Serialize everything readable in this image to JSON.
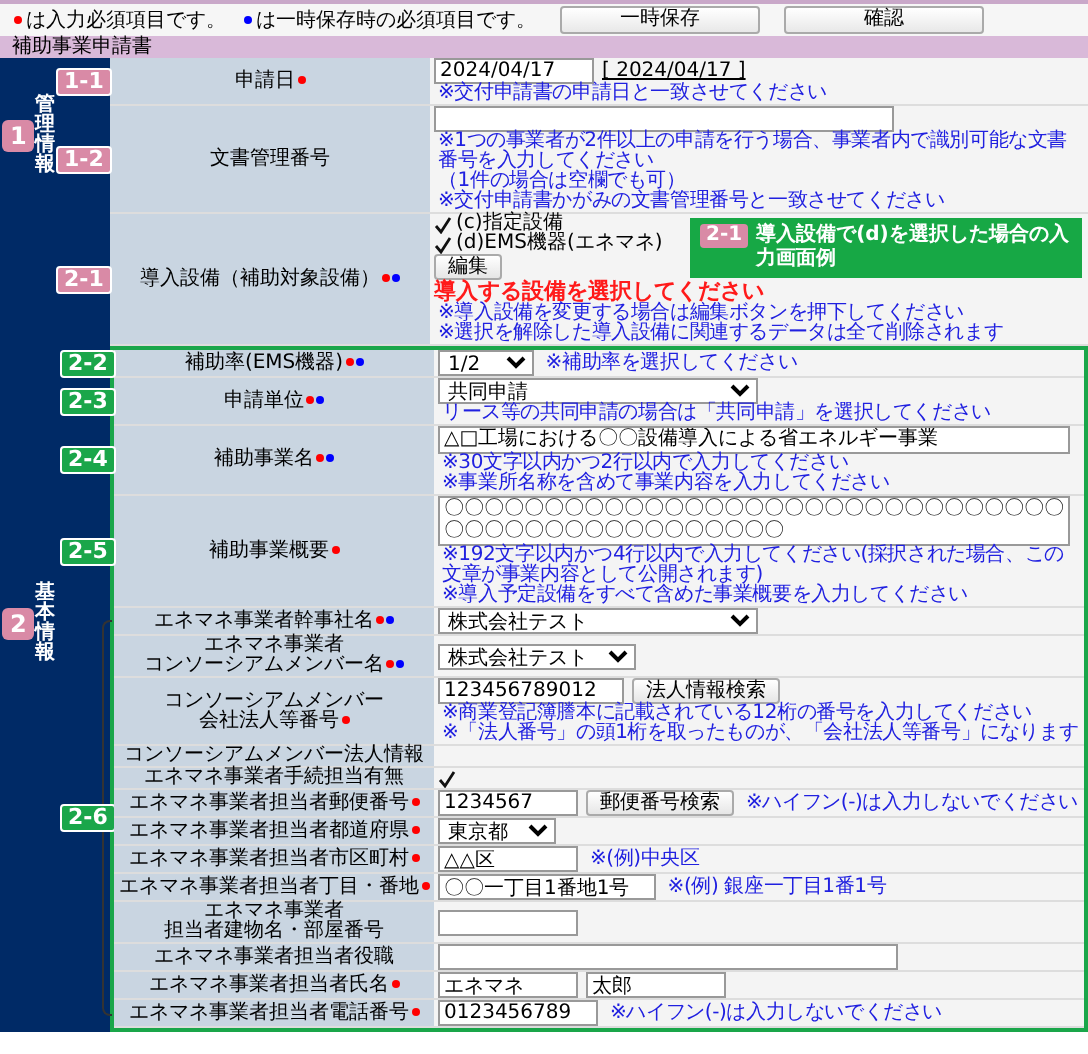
{
  "toolbar": {
    "buttons": [
      {
        "label": "一時保存"
      },
      {
        "label": "確認"
      }
    ]
  },
  "legend": [
    {
      "color": "#ff0000",
      "text": "は入力必須項目です。"
    },
    {
      "color": "#0000ff",
      "text": "は一時保存時の必須項目です。"
    }
  ],
  "form_title": "補助事業申請書",
  "sections": [
    {
      "badge": {
        "label": "1",
        "color": "#d98aa6"
      },
      "title": "管理情報",
      "rows": [
        {
          "badge": {
            "label": "1-1",
            "color": "#d98aa6"
          },
          "label": [
            "申請日"
          ],
          "required": true,
          "required_on_save": false,
          "controls": [
            {
              "kind": "input",
              "value": "2024/04/17"
            },
            {
              "kind": "reference",
              "value": "[ 2024/04/17 ]"
            }
          ],
          "notes": [
            "※交付申請書の申請日と一致させてください"
          ]
        },
        {
          "badge": {
            "label": "1-2",
            "color": "#d98aa6"
          },
          "label": [
            "文書管理番号"
          ],
          "required": false,
          "required_on_save": false,
          "controls": [
            {
              "kind": "wide_input"
            }
          ],
          "notes": [
            "※1つの事業者が2件以上の申請を行う場合、事業者内で識別可能な文書番号を入力してください",
            "（1件の場合は空欄でも可）",
            "※交付申請書かがみの文書管理番号と一致させてください"
          ]
        }
      ]
    },
    {
      "badge": {
        "label": "2",
        "color": "#d98aa6"
      },
      "title": "基本情報",
      "rows": [
        {
          "badge": {
            "label": "2-1",
            "color": "#d98aa6"
          },
          "label": [
            "導入設備（補助対象設備）"
          ],
          "required": true,
          "required_on_save": true,
          "controls": [
            {
              "kind": "check",
              "checked": true,
              "label": "(c)指定設備"
            },
            {
              "kind": "check",
              "checked": true,
              "label": "(d)EMS機器(エネマネ)"
            },
            {
              "kind": "button",
              "label": "編集"
            }
          ],
          "alert": "導入する設備を選択してください",
          "notes": [
            "※導入設備を変更する場合は編集ボタンを押下してください",
            "※選択を解除した導入設備に関連するデータは全て削除されます"
          ],
          "callout": {
            "badge": {
              "label": "2-1",
              "color": "#d98aa6"
            },
            "text": "導入設備で(d)を選択した場合の入力画面例"
          }
        }
      ],
      "box": {
        "rows": [
          {
            "badge": {
              "label": "2-2",
              "color": "#1aa64a"
            },
            "label": [
              "補助率(EMS機器)"
            ],
            "required": true,
            "required_on_save": true,
            "controls": [
              {
                "kind": "select",
                "value": "1/2"
              }
            ],
            "notes": [
              "※補助率を選択してください"
            ]
          },
          {
            "badge": {
              "label": "2-3",
              "color": "#1aa64a"
            },
            "label": [
              "申請単位"
            ],
            "required": true,
            "required_on_save": true,
            "controls": [
              {
                "kind": "wide_select",
                "value": "共同申請"
              }
            ],
            "notes": [
              "リース等の共同申請の場合は「共同申請」を選択してください"
            ]
          },
          {
            "badge": {
              "label": "2-4",
              "color": "#1aa64a"
            },
            "label": [
              "補助事業名"
            ],
            "required": true,
            "required_on_save": true,
            "controls": [
              {
                "kind": "textarea",
                "value": "△□工場における〇〇設備導入による省エネルギー事業"
              }
            ],
            "notes": [
              "※30文字以内かつ2行以内で入力してください",
              "※事業所名称を含めて事業内容を入力してください"
            ]
          },
          {
            "badge": {
              "label": "2-5",
              "color": "#1aa64a"
            },
            "label": [
              "補助事業概要"
            ],
            "required": true,
            "required_on_save": false,
            "controls": [
              {
                "kind": "textarea",
                "value": "〇〇〇〇〇〇〇〇〇〇〇〇〇〇〇〇〇〇〇〇〇〇〇〇〇〇〇〇〇〇〇〇〇〇〇〇〇〇〇〇〇〇〇〇〇〇〇〇"
              }
            ],
            "notes": [
              "※192文字以内かつ4行以内で入力してください(採択された場合、この文章が事業内容として公開されます)",
              "※導入予定設備をすべて含めた事業概要を入力してください"
            ]
          }
        ],
        "group": {
          "badge": {
            "label": "2-6",
            "color": "#1aa64a"
          },
          "rows": [
            {
              "label": [
                "エネマネ事業者",
                "幹事社名"
              ],
              "required": true,
              "required_on_save": true,
              "controls": [
                {
                  "kind": "wide_select",
                  "value": "株式会社テスト"
                }
              ]
            },
            {
              "label": [
                "エネマネ事業者",
                "コンソーシアムメンバー名"
              ],
              "required": true,
              "required_on_save": true,
              "controls": [
                {
                  "kind": "select",
                  "value": "株式会社テスト"
                }
              ]
            },
            {
              "label": [
                "コンソーシアムメンバー",
                "会社法人等番号"
              ],
              "required": true,
              "required_on_save": false,
              "controls": [
                {
                  "kind": "input",
                  "value": "123456789012"
                },
                {
                  "kind": "button",
                  "label": "法人情報検索"
                }
              ],
              "notes": [
                "※商業登記簿謄本に記載されている12桁の番号を入力してください",
                "※「法人番号」の頭1桁を取ったものが、「会社法人等番号」になります"
              ]
            },
            {
              "label": [
                "コンソーシアムメンバー",
                "法人情報"
              ],
              "required": false,
              "required_on_save": false,
              "controls": []
            },
            {
              "label": [
                "エネマネ事業者",
                "手続担当有無"
              ],
              "required": false,
              "required_on_save": false,
              "controls": [
                {
                  "kind": "check",
                  "checked": true
                }
              ]
            },
            {
              "label": [
                "エネマネ事業者",
                "担当者郵便番号"
              ],
              "required": true,
              "required_on_save": false,
              "controls": [
                {
                  "kind": "input",
                  "value": "1234567"
                },
                {
                  "kind": "button",
                  "label": "郵便番号検索"
                }
              ],
              "notes": [
                "※ハイフン(-)は入力しないでください"
              ]
            },
            {
              "label": [
                "エネマネ事業者",
                "担当者都道府県"
              ],
              "required": true,
              "required_on_save": false,
              "controls": [
                {
                  "kind": "select",
                  "value": "東京都"
                }
              ]
            },
            {
              "label": [
                "エネマネ事業者",
                "担当者市区町村"
              ],
              "required": true,
              "required_on_save": false,
              "controls": [
                {
                  "kind": "input",
                  "value": "△△区"
                }
              ],
              "notes": [
                "※(例)中央区"
              ]
            },
            {
              "label": [
                "エネマネ事業者",
                "担当者丁目・番地"
              ],
              "required": true,
              "required_on_save": false,
              "controls": [
                {
                  "kind": "input",
                  "value": "〇〇一丁目1番地1号"
                }
              ],
              "notes": [
                "※(例) 銀座一丁目1番1号"
              ]
            },
            {
              "label": [
                "エネマネ事業者",
                "担当者建物名・部屋番号"
              ],
              "required": false,
              "required_on_save": false,
              "controls": [
                {
                  "kind": "input"
                }
              ]
            },
            {
              "label": [
                "エネマネ事業者",
                "担当者役職"
              ],
              "required": false,
              "required_on_save": false,
              "controls": [
                {
                  "kind": "wide_input"
                }
              ]
            },
            {
              "label": [
                "エネマネ事業者",
                "担当者氏名"
              ],
              "required": true,
              "required_on_save": false,
              "controls": [
                {
                  "kind": "input",
                  "value": "エネマネ"
                },
                {
                  "kind": "input",
                  "value": "太郎"
                }
              ]
            },
            {
              "label": [
                "エネマネ事業者",
                "担当者電話番号"
              ],
              "required": true,
              "required_on_save": false,
              "controls": [
                {
                  "kind": "input",
                  "value": "0123456789"
                }
              ],
              "notes": [
                "※ハイフン(-)は入力しないでください"
              ]
            }
          ]
        }
      }
    }
  ]
}
